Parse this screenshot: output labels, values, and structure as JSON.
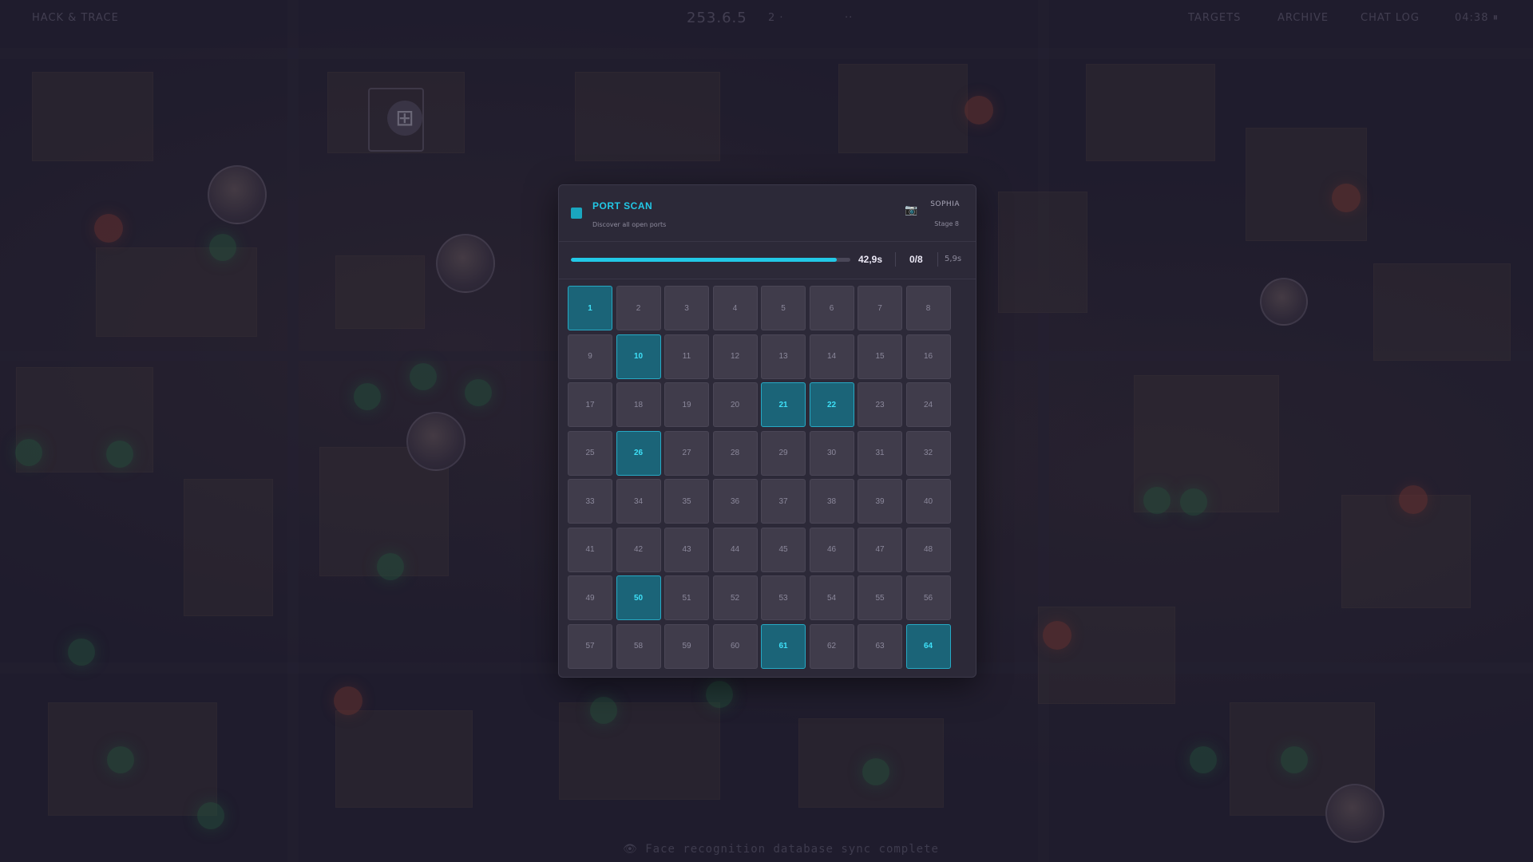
{
  "topbar": {
    "left": "HACK & TRACE",
    "center_score": "253.6.5",
    "center_mid": "2 ·",
    "center_right": "··",
    "item1": "TARGETS",
    "item2": "ARCHIVE",
    "item3": "CHAT LOG",
    "clock": "04:38 ⏸"
  },
  "status_message": "Face recognition database sync complete",
  "modal": {
    "title": "PORT SCAN",
    "subtitle": "Discover all open ports",
    "player_name": "SOPHIA",
    "stage": "Stage 8",
    "player_icon": "camera-icon",
    "progress": {
      "fraction": 0.95,
      "time": "42,9s",
      "count": "0/8",
      "extra": "5,9s"
    },
    "ports": [
      {
        "n": "1",
        "open": true
      },
      {
        "n": "2",
        "open": false
      },
      {
        "n": "3",
        "open": false
      },
      {
        "n": "4",
        "open": false
      },
      {
        "n": "5",
        "open": false
      },
      {
        "n": "6",
        "open": false
      },
      {
        "n": "7",
        "open": false
      },
      {
        "n": "8",
        "open": false
      },
      {
        "n": "9",
        "open": false
      },
      {
        "n": "10",
        "open": true
      },
      {
        "n": "11",
        "open": false
      },
      {
        "n": "12",
        "open": false
      },
      {
        "n": "13",
        "open": false
      },
      {
        "n": "14",
        "open": false
      },
      {
        "n": "15",
        "open": false
      },
      {
        "n": "16",
        "open": false
      },
      {
        "n": "17",
        "open": false
      },
      {
        "n": "18",
        "open": false
      },
      {
        "n": "19",
        "open": false
      },
      {
        "n": "20",
        "open": false
      },
      {
        "n": "21",
        "open": true
      },
      {
        "n": "22",
        "open": true
      },
      {
        "n": "23",
        "open": false
      },
      {
        "n": "24",
        "open": false
      },
      {
        "n": "25",
        "open": false
      },
      {
        "n": "26",
        "open": true
      },
      {
        "n": "27",
        "open": false
      },
      {
        "n": "28",
        "open": false
      },
      {
        "n": "29",
        "open": false
      },
      {
        "n": "30",
        "open": false
      },
      {
        "n": "31",
        "open": false
      },
      {
        "n": "32",
        "open": false
      },
      {
        "n": "33",
        "open": false
      },
      {
        "n": "34",
        "open": false
      },
      {
        "n": "35",
        "open": false
      },
      {
        "n": "36",
        "open": false
      },
      {
        "n": "37",
        "open": false
      },
      {
        "n": "38",
        "open": false
      },
      {
        "n": "39",
        "open": false
      },
      {
        "n": "40",
        "open": false
      },
      {
        "n": "41",
        "open": false
      },
      {
        "n": "42",
        "open": false
      },
      {
        "n": "43",
        "open": false
      },
      {
        "n": "44",
        "open": false
      },
      {
        "n": "45",
        "open": false
      },
      {
        "n": "46",
        "open": false
      },
      {
        "n": "47",
        "open": false
      },
      {
        "n": "48",
        "open": false
      },
      {
        "n": "49",
        "open": false
      },
      {
        "n": "50",
        "open": true
      },
      {
        "n": "51",
        "open": false
      },
      {
        "n": "52",
        "open": false
      },
      {
        "n": "53",
        "open": false
      },
      {
        "n": "54",
        "open": false
      },
      {
        "n": "55",
        "open": false
      },
      {
        "n": "56",
        "open": false
      },
      {
        "n": "57",
        "open": false
      },
      {
        "n": "58",
        "open": false
      },
      {
        "n": "59",
        "open": false
      },
      {
        "n": "60",
        "open": false
      },
      {
        "n": "61",
        "open": true
      },
      {
        "n": "62",
        "open": false
      },
      {
        "n": "63",
        "open": false
      },
      {
        "n": "64",
        "open": true
      }
    ]
  },
  "colors": {
    "accent": "#22c8e6",
    "open_cell_bg": "#1b6478",
    "cell_bg": "#403c4b",
    "panel_bg": "#2c2938"
  }
}
